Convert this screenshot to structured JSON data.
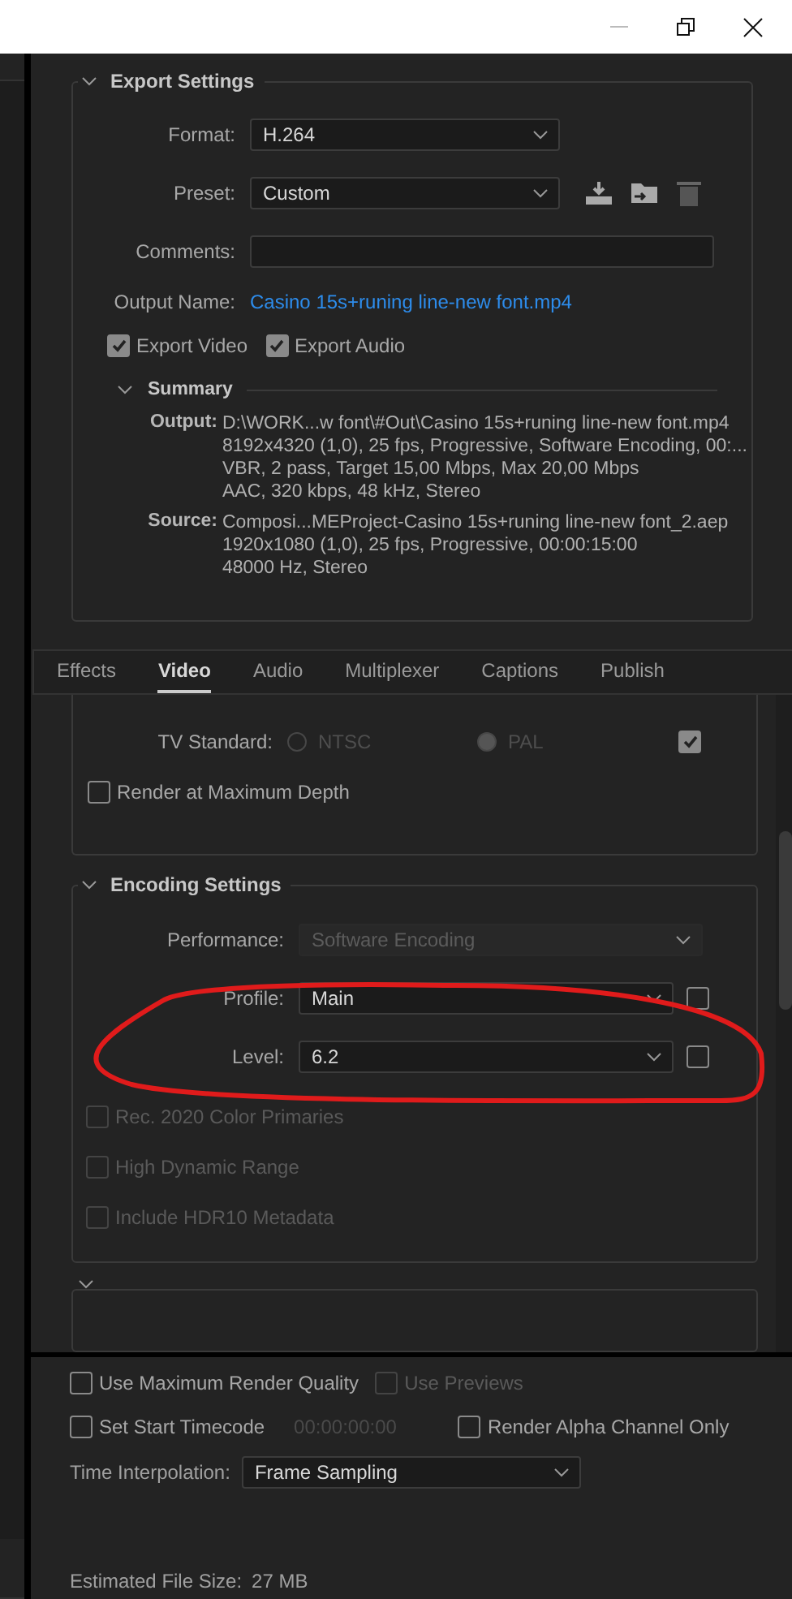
{
  "export_settings": {
    "title": "Export Settings",
    "format": {
      "label": "Format:",
      "value": "H.264"
    },
    "preset": {
      "label": "Preset:",
      "value": "Custom"
    },
    "comments": {
      "label": "Comments:"
    },
    "output_name": {
      "label": "Output Name:",
      "value": "Casino 15s+runing line-new font.mp4"
    },
    "checkboxes": [
      {
        "label": "Export Video",
        "checked": true
      },
      {
        "label": "Export Audio",
        "checked": true
      }
    ],
    "summary": {
      "title": "Summary",
      "entries": [
        {
          "label": "Output:",
          "lines": [
            "D:\\WORK...w font\\#Out\\Casino 15s+runing line-new font.mp4",
            "8192x4320 (1,0), 25 fps, Progressive, Software Encoding, 00:...",
            "VBR, 2 pass, Target 15,00 Mbps, Max 20,00 Mbps",
            "AAC, 320 kbps, 48 kHz, Stereo"
          ]
        },
        {
          "label": "Source:",
          "lines": [
            "Composi...MEProject-Casino 15s+runing line-new font_2.aep",
            "1920x1080 (1,0), 25 fps, Progressive, 00:00:15:00",
            "48000 Hz, Stereo"
          ]
        }
      ]
    }
  },
  "tabs": [
    {
      "label": "Effects",
      "selected": false
    },
    {
      "label": "Video",
      "selected": true
    },
    {
      "label": "Audio",
      "selected": false
    },
    {
      "label": "Multiplexer",
      "selected": false
    },
    {
      "label": "Captions",
      "selected": false
    },
    {
      "label": "Publish",
      "selected": false
    }
  ],
  "video": {
    "tv_standard": {
      "label": "TV Standard:",
      "options": [
        {
          "label": "NTSC",
          "selected": false
        },
        {
          "label": "PAL",
          "selected": true
        }
      ],
      "checked": true
    },
    "render_max_depth": {
      "label": "Render at Maximum Depth",
      "checked": false
    }
  },
  "encoding": {
    "title": "Encoding Settings",
    "fields": [
      {
        "label": "Performance:",
        "value": "Software Encoding",
        "disabled": true
      },
      {
        "label": "Profile:",
        "value": "Main",
        "disabled": false,
        "checked": false
      },
      {
        "label": "Level:",
        "value": "6.2",
        "disabled": false,
        "checked": false
      }
    ],
    "checkboxes": [
      {
        "label": "Rec. 2020 Color Primaries",
        "checked": false,
        "disabled": true
      },
      {
        "label": "High Dynamic Range",
        "checked": false,
        "disabled": true
      },
      {
        "label": "Include HDR10 Metadata",
        "checked": false,
        "disabled": true
      }
    ]
  },
  "bottom": {
    "rows": [
      [
        {
          "label": "Use Maximum Render Quality",
          "checked": false,
          "disabled": false
        },
        {
          "label": "Use Previews",
          "checked": false,
          "disabled": true
        }
      ],
      [
        {
          "label": "Set Start Timecode",
          "checked": false,
          "disabled": false,
          "timecode": "00:00:00:00"
        },
        {
          "label": "Render Alpha Channel Only",
          "checked": false,
          "disabled": false
        }
      ]
    ],
    "time_interpolation": {
      "label": "Time Interpolation:",
      "value": "Frame Sampling"
    },
    "file_size": {
      "label": "Estimated File Size:",
      "value": "27 MB"
    }
  }
}
